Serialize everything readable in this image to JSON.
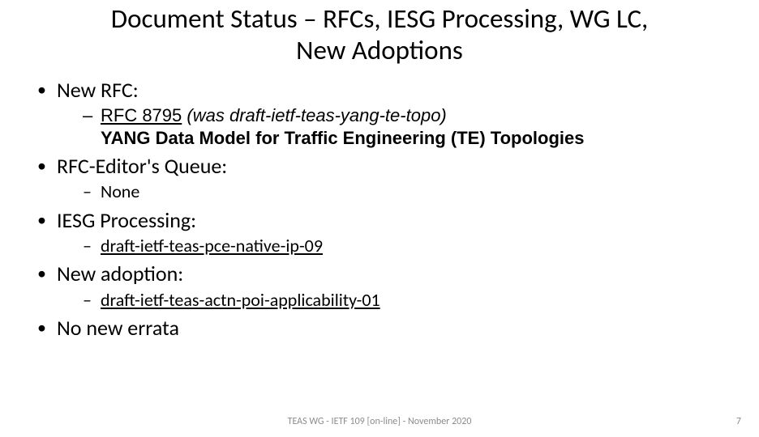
{
  "title_line1": "Document Status – RFCs, IESG Processing, WG LC,",
  "title_line2": "New Adoptions",
  "sections": {
    "new_rfc": {
      "heading": "New RFC:",
      "link": "RFC 8795",
      "paren": "(was draft-ietf-teas-yang-te-topo)",
      "bold": "YANG Data Model for Traffic Engineering (TE) Topologies"
    },
    "rfc_editor": {
      "heading": "RFC-Editor's Queue:",
      "item": "None"
    },
    "iesg": {
      "heading": "IESG Processing:",
      "item": "draft-ietf-teas-pce-native-ip-09"
    },
    "adoption": {
      "heading": "New adoption:",
      "item": "draft-ietf-teas-actn-poi-applicability-01"
    },
    "errata": {
      "heading": "No new errata"
    }
  },
  "footer": {
    "center": "TEAS WG - IETF 109 [on-line] - November 2020",
    "page": "7"
  }
}
